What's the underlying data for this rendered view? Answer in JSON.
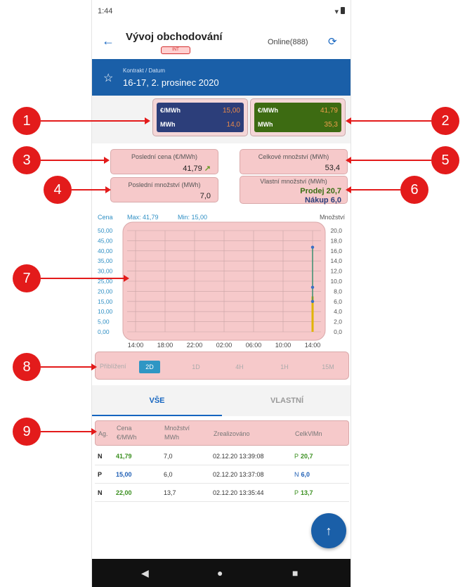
{
  "status": {
    "time": "1:44"
  },
  "appbar": {
    "title": "Vývoj obchodování",
    "badge": "INT",
    "online": "Online(888)"
  },
  "contract": {
    "label": "Kontrakt / Datum",
    "value": "16-17, 2. prosinec 2020"
  },
  "price_boxes": {
    "left": {
      "row1_label": "€/MWh",
      "row1_value": "15,00",
      "row2_label": "MWh",
      "row2_value": "14,0"
    },
    "right": {
      "row1_label": "€/MWh",
      "row1_value": "41,79",
      "row2_label": "MWh",
      "row2_value": "35,3"
    }
  },
  "stats": {
    "last_price_label": "Poslední cena (€/MWh)",
    "last_price_value": "41,79",
    "last_qty_label": "Poslední množství (MWh)",
    "last_qty_value": "7,0",
    "total_qty_label": "Celkové množství (MWh)",
    "total_qty_value": "53,4",
    "own_qty_label": "Vlastní množství (MWh)",
    "own_sell": "Prodej 20,7",
    "own_buy": "Nákup 6,0"
  },
  "chart_data": {
    "type": "line",
    "left_axis_label": "Cena",
    "max_label": "Max: 41,79",
    "min_label": "Min: 15,00",
    "right_axis_label": "Množství",
    "left_ticks": [
      "50,00",
      "45,00",
      "40,00",
      "35,00",
      "30,00",
      "25,00",
      "20,00",
      "15,00",
      "10,00",
      "5,00",
      "0,00"
    ],
    "right_ticks": [
      "20,0",
      "18,0",
      "16,0",
      "14,0",
      "12,0",
      "10,0",
      "8,0",
      "6,0",
      "4,0",
      "2,0",
      "0,0"
    ],
    "x_ticks": [
      "14:00",
      "18:00",
      "22:00",
      "02:00",
      "06:00",
      "10:00",
      "14:00"
    ],
    "ylim_price": [
      0,
      50
    ],
    "ylim_qty": [
      0,
      20
    ],
    "price_series": [
      {
        "x": "13:35",
        "y": 22.0
      },
      {
        "x": "13:37",
        "y": 15.0
      },
      {
        "x": "13:39",
        "y": 41.79
      }
    ],
    "qty_bar": {
      "x": "13:39",
      "y": 7.0
    }
  },
  "zoom": {
    "label": "Přiblížení",
    "options": [
      "2D",
      "1D",
      "4H",
      "1H",
      "15M"
    ],
    "active": "2D"
  },
  "tabs": [
    {
      "label": "VŠE",
      "active": true
    },
    {
      "label": "VLASTNÍ",
      "active": false
    }
  ],
  "table": {
    "headers": {
      "ag": "Ag.",
      "cena": "Cena",
      "cena_unit": "€/MWh",
      "mnozstvi": "Množství",
      "mnozstvi_unit": "MWh",
      "zrealizovano": "Zrealizováno",
      "celk": "CelkVlMn"
    },
    "rows": [
      {
        "ag": "N",
        "cena": "41,79",
        "cena_color": "green",
        "mnozstvi": "7,0",
        "zrealizovano": "02.12.20 13:39:08",
        "celk_prefix": "P",
        "celk": "20,7",
        "celk_color": "green"
      },
      {
        "ag": "P",
        "cena": "15,00",
        "cena_color": "blue",
        "mnozstvi": "6,0",
        "zrealizovano": "02.12.20 13:37:08",
        "celk_prefix": "N",
        "celk": "6,0",
        "celk_color": "blue"
      },
      {
        "ag": "N",
        "cena": "22,00",
        "cena_color": "green",
        "mnozstvi": "13,7",
        "zrealizovano": "02.12.20 13:35:44",
        "celk_prefix": "P",
        "celk": "13,7",
        "celk_color": "green"
      }
    ]
  },
  "callouts": [
    "1",
    "2",
    "3",
    "4",
    "5",
    "6",
    "7",
    "8",
    "9"
  ],
  "colors": {
    "accent": "#1a5fa8",
    "callout": "#e31b1b",
    "highlight": "#f6c9ca"
  }
}
